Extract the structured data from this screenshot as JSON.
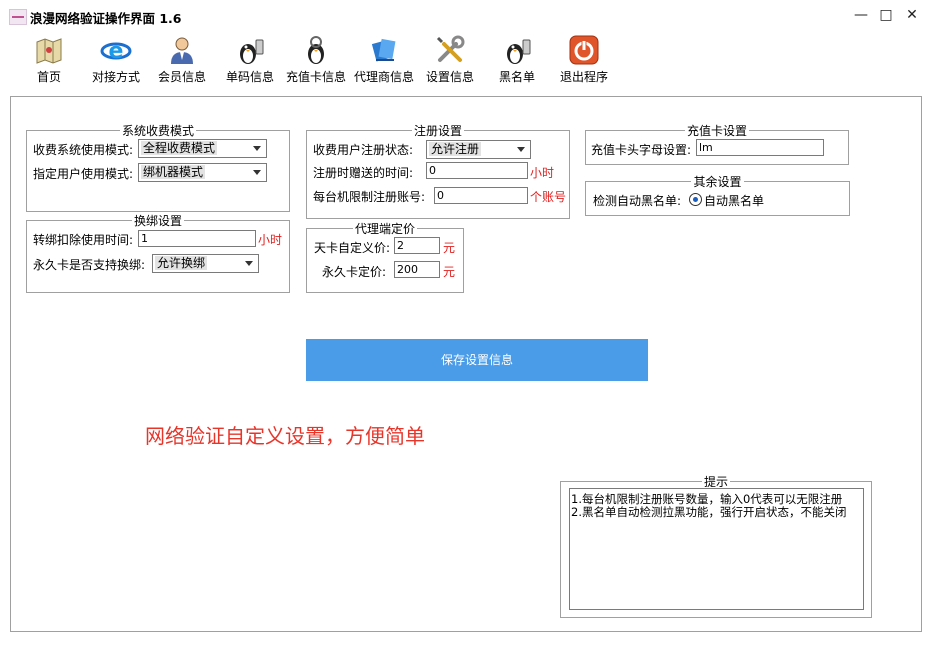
{
  "window": {
    "title": "浪漫网络验证操作界面 1.6",
    "controls": {
      "minimize": "—",
      "maximize": "□",
      "close": "✕"
    }
  },
  "toolbar": {
    "items": [
      {
        "label": "首页",
        "icon": "home-map-icon"
      },
      {
        "label": "对接方式",
        "icon": "connect-e-icon"
      },
      {
        "label": "会员信息",
        "icon": "member-person-icon"
      },
      {
        "label": "单码信息",
        "icon": "single-code-penguin-icon"
      },
      {
        "label": "充值卡信息",
        "icon": "recharge-card-penguin-icon"
      },
      {
        "label": "代理商信息",
        "icon": "agent-books-icon"
      },
      {
        "label": "设置信息",
        "icon": "settings-tools-icon"
      },
      {
        "label": "黑名单",
        "icon": "blacklist-penguin-icon"
      },
      {
        "label": "退出程序",
        "icon": "power-exit-icon"
      }
    ]
  },
  "billing": {
    "legend": "系统收费模式",
    "mode_label": "收费系统使用模式:",
    "mode_value": "全程收费模式",
    "user_mode_label": "指定用户使用模式:",
    "user_mode_value": "绑机器模式"
  },
  "rebind": {
    "legend": "换绑设置",
    "deduct_label": "转绑扣除使用时间:",
    "deduct_value": "1",
    "deduct_unit": "小时",
    "permanent_label": "永久卡是否支持换绑:",
    "permanent_value": "允许换绑"
  },
  "register": {
    "legend": "注册设置",
    "status_label": "收费用户注册状态:",
    "status_value": "允许注册",
    "gift_label": "注册时赠送的时间:",
    "gift_value": "0",
    "gift_unit": "小时",
    "limit_label": "每台机限制注册账号:",
    "limit_value": "0",
    "limit_unit": "个账号"
  },
  "agent": {
    "legend": "代理端定价",
    "day_label": "天卡自定义价:",
    "day_value": "2",
    "day_unit": "元",
    "perm_label": "永久卡定价:",
    "perm_value": "200",
    "perm_unit": "元"
  },
  "recharge": {
    "legend": "充值卡设置",
    "prefix_label": "充值卡头字母设置:",
    "prefix_value": "lm"
  },
  "other": {
    "legend": "其余设置",
    "detect_label": "检测自动黑名单:",
    "radio_label": "自动黑名单",
    "radio_checked": true
  },
  "save_button": "保存设置信息",
  "slogan": "网络验证自定义设置，方便简单",
  "tips": {
    "legend": "提示",
    "lines": [
      "1.每台机限制注册账号数量，输入0代表可以无限注册",
      "2.黑名单自动检测拉黑功能，强行开启状态，不能关闭"
    ]
  }
}
